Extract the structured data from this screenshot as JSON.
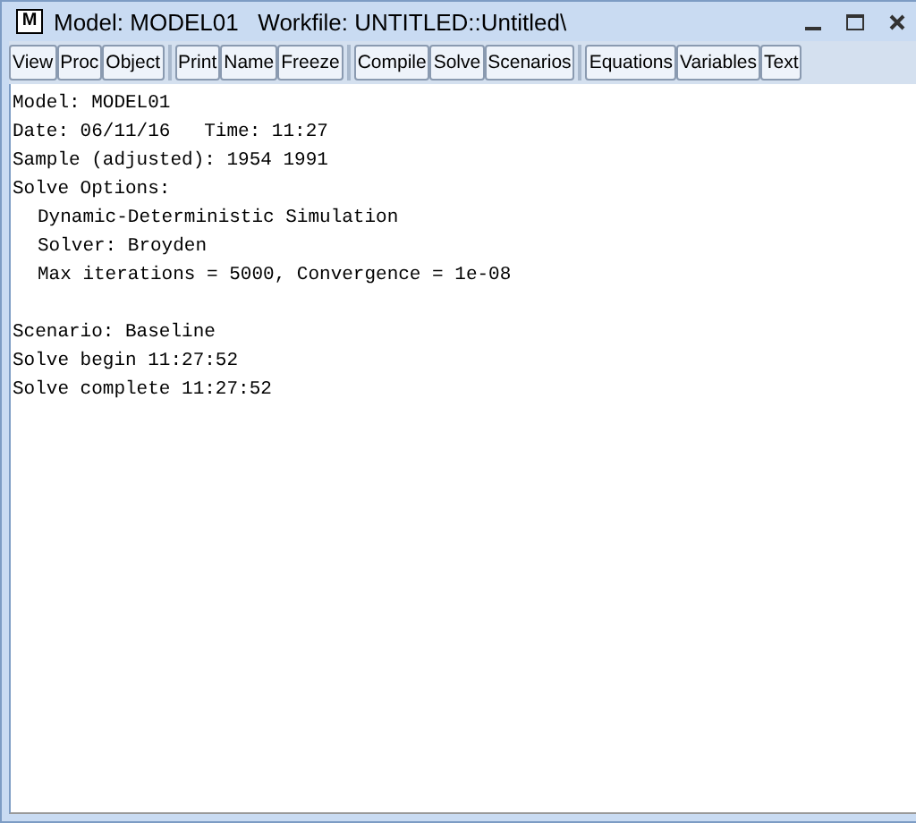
{
  "window": {
    "icon_letter": "M",
    "title": "Model: MODEL01   Workfile: UNTITLED::Untitled\\"
  },
  "toolbar_groups": [
    [
      "View",
      "Proc",
      "Object"
    ],
    [
      "Print",
      "Name",
      "Freeze"
    ],
    [
      "Compile",
      "Solve",
      "Scenarios"
    ],
    [
      "Equations",
      "Variables",
      "Text"
    ]
  ],
  "output_blocks": [
    [
      {
        "text": "Model: MODEL01"
      },
      {
        "text": "Date: 06/11/16   Time: 11:27"
      },
      {
        "text": "Sample (adjusted): 1954 1991"
      },
      {
        "text": "Solve Options:",
        "children": [
          {
            "text": "Dynamic-Deterministic Simulation"
          },
          {
            "text": "Solver: Broyden"
          },
          {
            "text": "Max iterations = 5000, Convergence = 1e-08"
          }
        ]
      }
    ],
    [
      {
        "text": "Scenario: Baseline"
      },
      {
        "text": "Solve begin 11:27:52"
      },
      {
        "text": "Solve complete 11:27:52"
      }
    ]
  ]
}
